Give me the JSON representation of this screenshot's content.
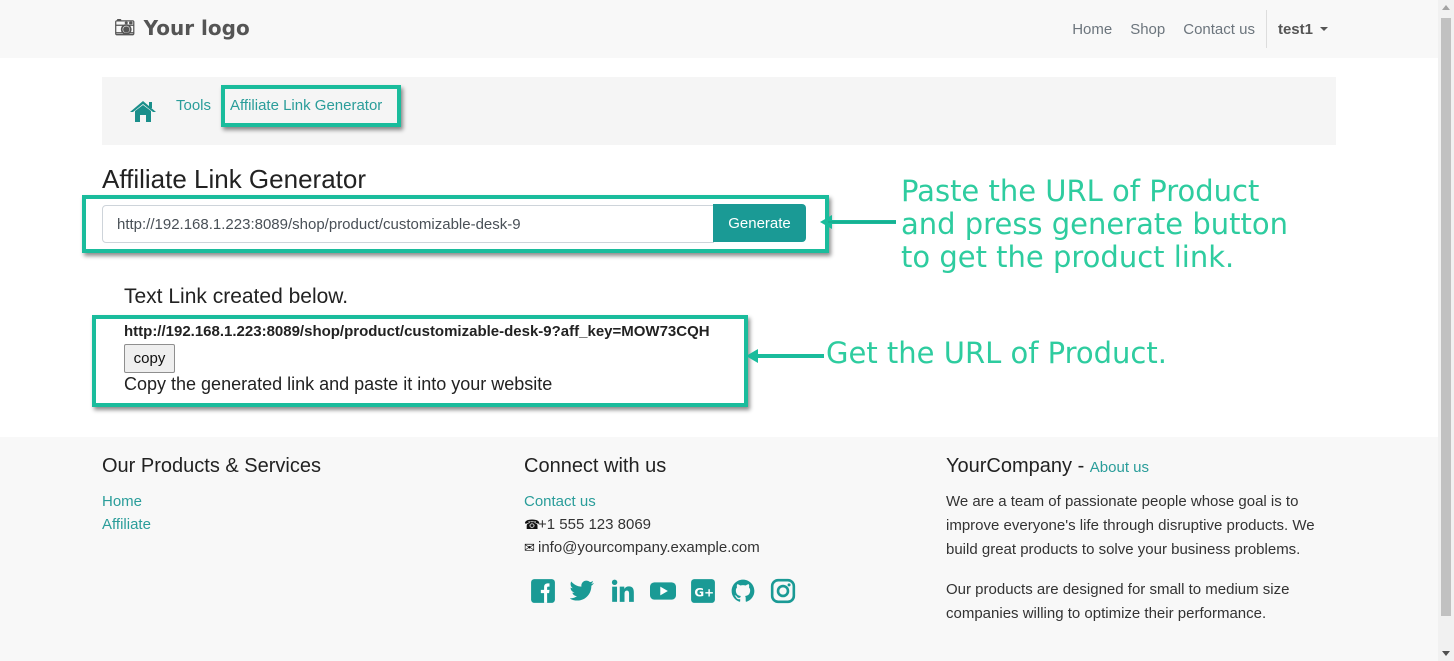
{
  "navbar": {
    "logo_text": "Your logo",
    "links": [
      "Home",
      "Shop",
      "Contact us"
    ],
    "user": "test1"
  },
  "breadcrumb": {
    "items": [
      "Tools",
      "Affiliate Link Generator"
    ]
  },
  "main": {
    "title": "Affiliate Link Generator",
    "url_value": "http://192.168.1.223:8089/shop/product/customizable-desk-9",
    "generate_label": "Generate",
    "created_title": "Text Link created below.",
    "generated_link": "http://192.168.1.223:8089/shop/product/customizable-desk-9?aff_key=MOW73CQH",
    "copy_label": "copy",
    "copy_hint": "Copy the generated link and paste it into your website"
  },
  "annotations": {
    "paste": "Paste the URL of Product and press generate button to get the product link.",
    "get": "Get the URL of Product."
  },
  "footer": {
    "products": {
      "title": "Our Products & Services",
      "links": [
        "Home",
        "Affiliate"
      ]
    },
    "connect": {
      "title": "Connect with us",
      "contact": "Contact us",
      "phone": "+1 555 123 8069",
      "email": "info@yourcompany.example.com",
      "social_icons": [
        "facebook-icon",
        "twitter-icon",
        "linkedin-icon",
        "youtube-icon",
        "google-plus-icon",
        "github-icon",
        "instagram-icon"
      ]
    },
    "company": {
      "name": "YourCompany",
      "separator": " - ",
      "about": "About us",
      "text1": "We are a team of passionate people whose goal is to improve everyone's life through disruptive products. We build great products to solve your business problems.",
      "text2": "Our products are designed for small to medium size companies willing to optimize their performance."
    }
  },
  "colors": {
    "accent": "#1a9a95",
    "annotation": "#2ecc9f",
    "highlight_border": "#1abc9c"
  }
}
